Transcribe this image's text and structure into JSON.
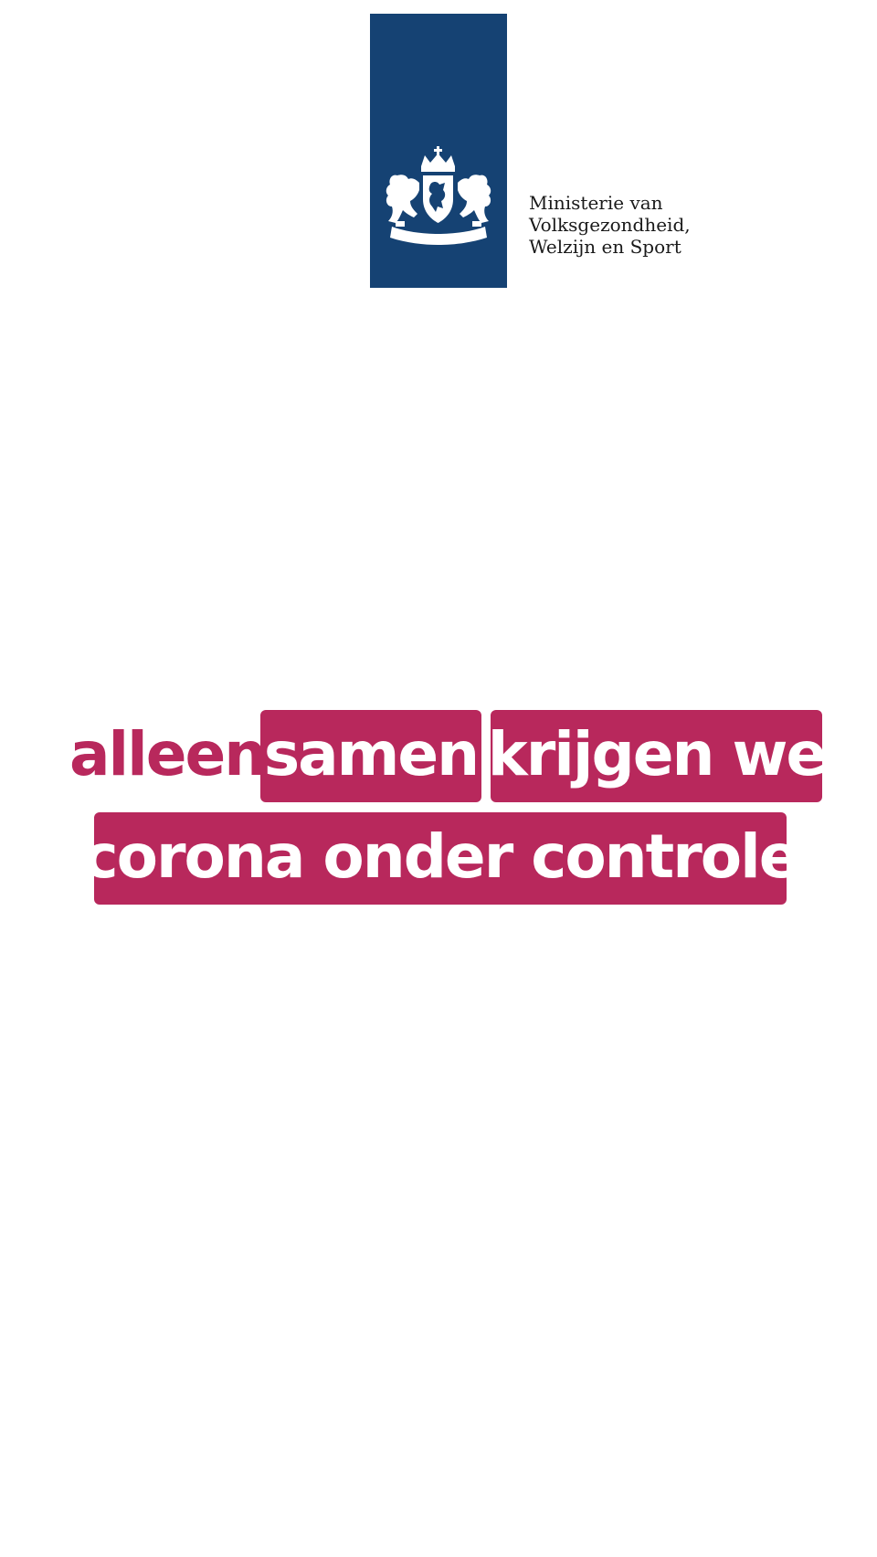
{
  "logo": {
    "ministry_name_lines": [
      "Ministerie van",
      "Volksgezondheid,",
      "Welzijn en Sport"
    ],
    "emblem": "coat-of-arms-icon",
    "brand_color": "#154273"
  },
  "slogan": {
    "plain_word": "alleen",
    "box_samen": "samen",
    "box_krijgen": "krijgen we",
    "box_corona": "corona onder controle",
    "accent_color": "#b8285c"
  }
}
